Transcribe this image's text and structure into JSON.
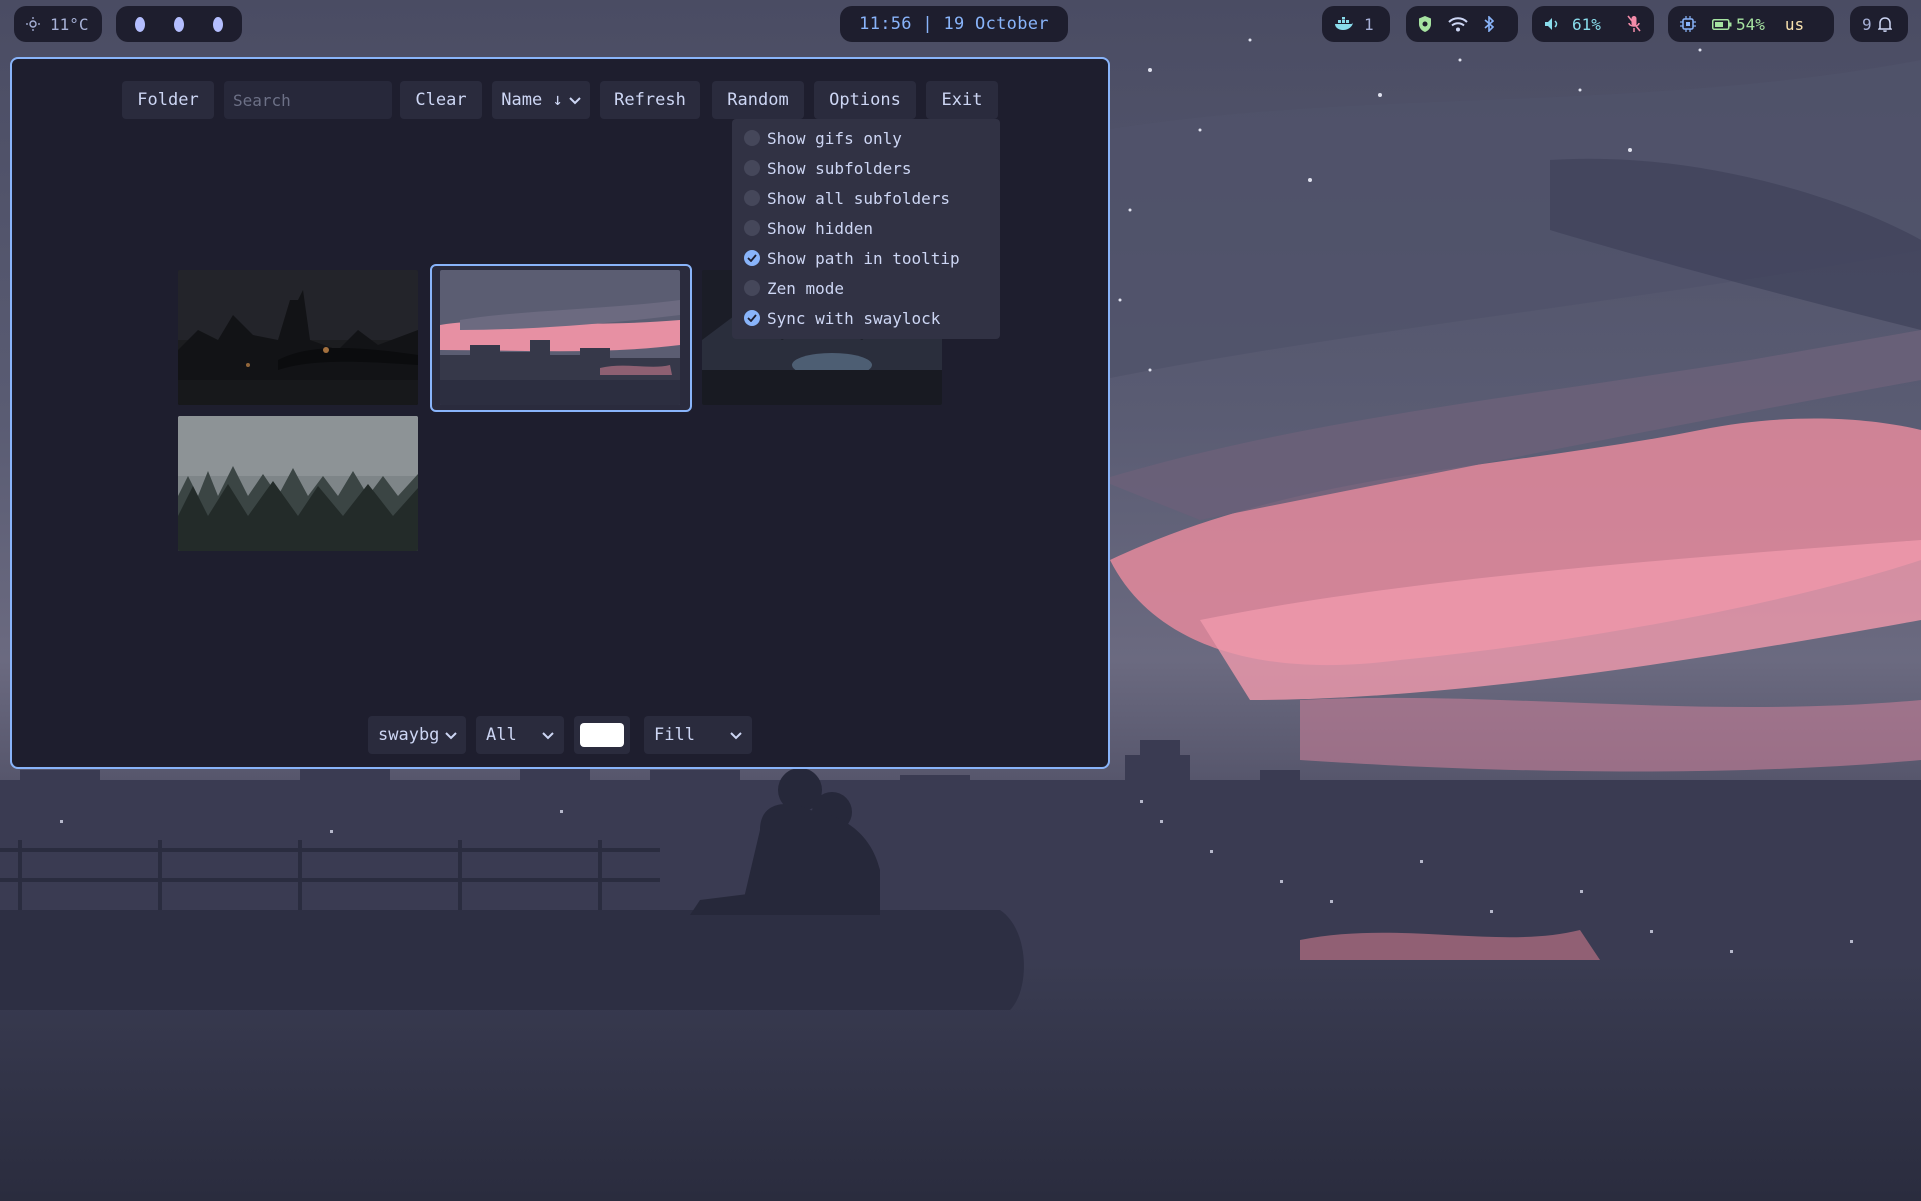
{
  "topbar": {
    "weather": {
      "icon": "sun-icon",
      "text": "11°C"
    },
    "workspaces": [
      "1",
      "2",
      "3"
    ],
    "clock": "11:56 | 19 October",
    "docker": {
      "icon": "docker-whale-icon",
      "count": "1"
    },
    "network_icons": [
      "shield-icon",
      "wifi-icon",
      "bluetooth-icon"
    ],
    "volume": {
      "icon": "speaker-icon",
      "text": "61%",
      "mic_icon": "mic-muted-icon"
    },
    "system": {
      "cpu_icon": "cpu-icon",
      "battery_icon": "battery-icon",
      "battery": "54%",
      "layout": "us"
    },
    "notifications": {
      "count": "9",
      "icon": "bell-icon"
    }
  },
  "toolbar": {
    "folder": "Folder",
    "search_placeholder": "Search",
    "clear": "Clear",
    "sort": "Name ↓",
    "refresh": "Refresh",
    "random": "Random",
    "options": "Options",
    "exit": "Exit"
  },
  "options_menu": [
    {
      "label": "Show gifs only",
      "checked": false
    },
    {
      "label": "Show subfolders",
      "checked": false
    },
    {
      "label": "Show all subfolders",
      "checked": false
    },
    {
      "label": "Show hidden",
      "checked": false
    },
    {
      "label": "Show path in tooltip",
      "checked": true
    },
    {
      "label": "Zen mode",
      "checked": false
    },
    {
      "label": "Sync with swaylock",
      "checked": true
    }
  ],
  "thumbnails": [
    {
      "subject": "dark city bridge at night",
      "selected": false
    },
    {
      "subject": "pink sunset over city skyline",
      "selected": true
    },
    {
      "subject": "misty blue mountain valley",
      "selected": false
    },
    {
      "subject": "foggy pine forest",
      "selected": false
    }
  ],
  "bottom": {
    "backend": "swaybg",
    "filter": "All",
    "color": "#ffffff",
    "fill": "Fill"
  },
  "colors": {
    "accent": "#89b4fa",
    "window_bg": "#1e1e2e",
    "button_bg": "#2a2b3d",
    "menu_bg": "#313244",
    "text": "#cdd6f4"
  }
}
